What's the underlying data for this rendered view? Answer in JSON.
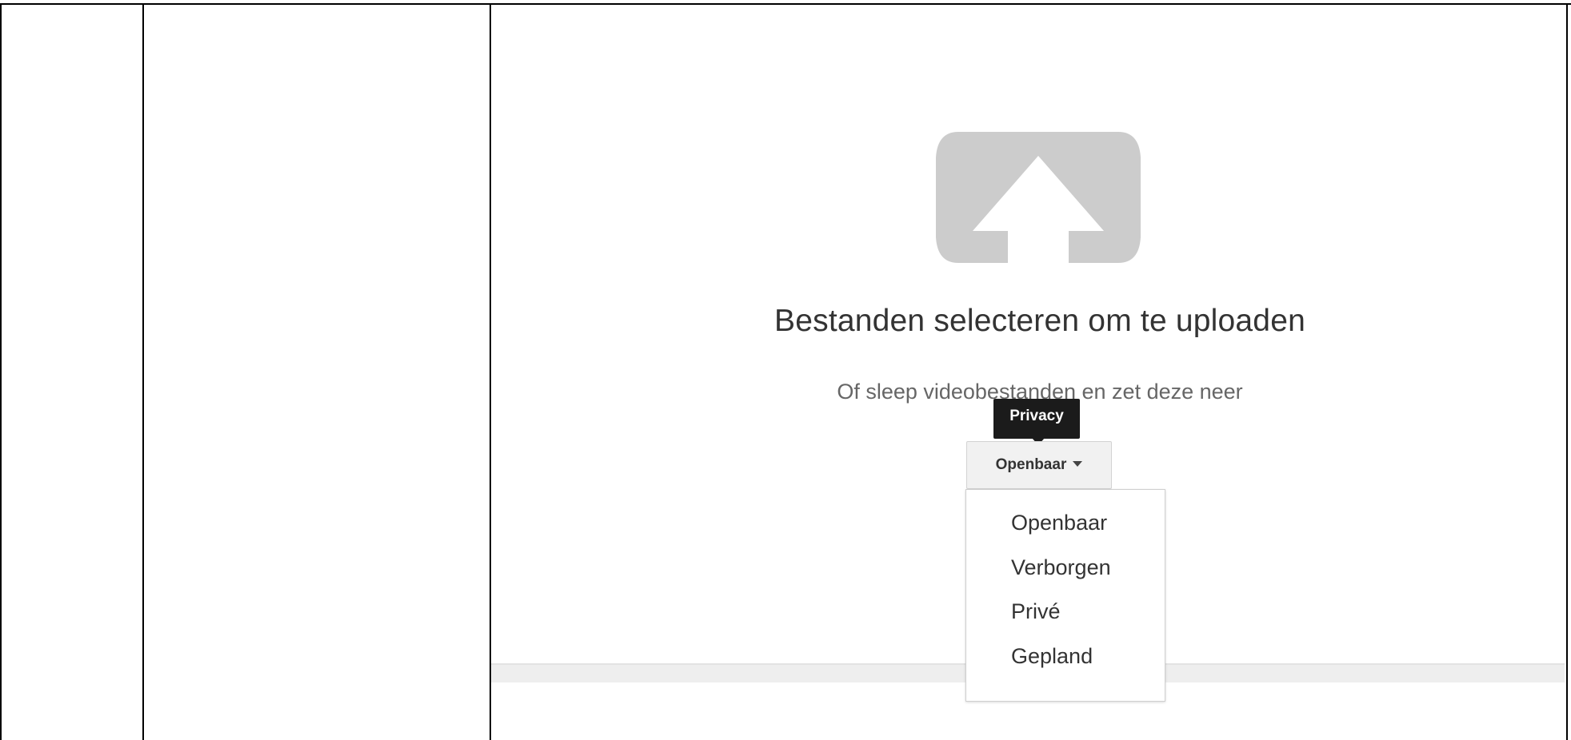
{
  "upload": {
    "title": "Bestanden selecteren om te uploaden",
    "subtitle": "Of sleep videobestanden en zet deze neer",
    "icon": "upload-arrow-icon"
  },
  "privacy": {
    "tooltip": "Privacy",
    "selected": "Openbaar",
    "options": [
      "Openbaar",
      "Verborgen",
      "Privé",
      "Gepland"
    ]
  },
  "colors": {
    "icon_gray": "#cccccc",
    "tooltip_bg": "#1b1b1b",
    "button_bg": "#f1f1f1"
  }
}
